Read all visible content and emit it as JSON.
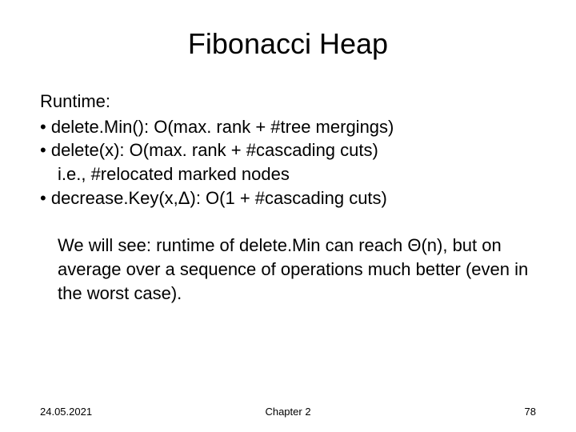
{
  "title": "Fibonacci Heap",
  "subhead": "Runtime:",
  "bullets": {
    "b1": "delete.Min(): O(max. rank + #tree mergings)",
    "b2": "delete(x): O(max. rank + #cascading cuts)",
    "b2_cont": "i.e., #relocated marked nodes",
    "b3": "decrease.Key(x,Δ): O(1 + #cascading cuts)"
  },
  "paragraph": "We will see: runtime of delete.Min can reach Θ(n), but on average over a sequence of operations much better (even in the worst case).",
  "footer": {
    "date": "24.05.2021",
    "chapter": "Chapter 2",
    "page": "78"
  }
}
